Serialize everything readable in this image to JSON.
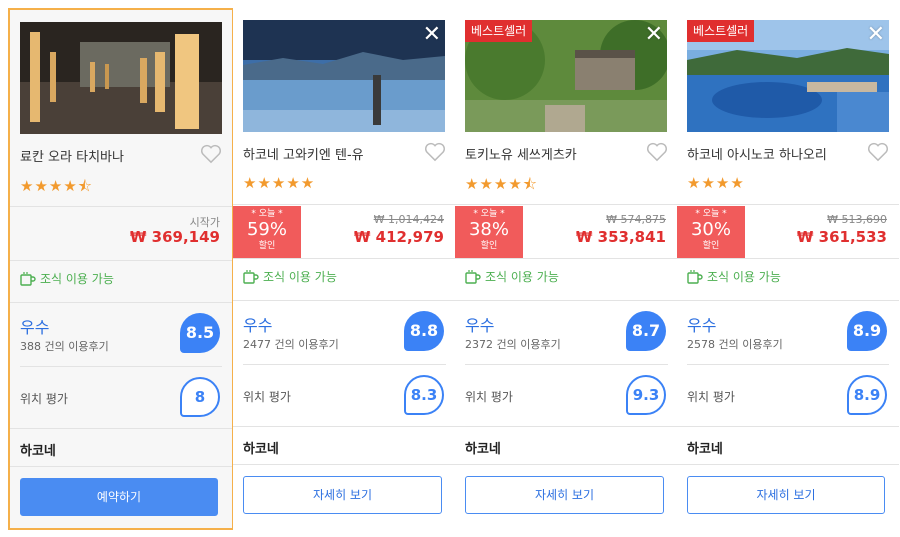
{
  "hotels": [
    {
      "name": "료칸 오라 타치바나",
      "stars": "★★★★⯪",
      "badge": "",
      "price_from_label": "시작가",
      "price": "₩ 369,149",
      "original_price": "",
      "discount_today": "",
      "discount_pct": "",
      "discount_word": "",
      "breakfast": "조식 이용 가능",
      "rating_word": "우수",
      "reviews": "388 건의 이용후기",
      "score": "8.5",
      "location_label": "위치 평가",
      "location_score": "8",
      "region": "하코네",
      "button": "예약하기"
    },
    {
      "name": "하코네 고와키엔 텐-유",
      "stars": "★★★★★",
      "badge": "",
      "price_from_label": "",
      "price": "₩ 412,979",
      "original_price": "₩ 1,014,424",
      "discount_today": "* 오늘 *",
      "discount_pct": "59%",
      "discount_word": "할인",
      "breakfast": "조식 이용 가능",
      "rating_word": "우수",
      "reviews": "2477 건의 이용후기",
      "score": "8.8",
      "location_label": "위치 평가",
      "location_score": "8.3",
      "region": "하코네",
      "button": "자세히 보기"
    },
    {
      "name": "토키노유 세쓰게츠카",
      "stars": "★★★★⯪",
      "badge": "베스트셀러",
      "price_from_label": "",
      "price": "₩ 353,841",
      "original_price": "₩ 574,875",
      "discount_today": "* 오늘 *",
      "discount_pct": "38%",
      "discount_word": "할인",
      "breakfast": "조식 이용 가능",
      "rating_word": "우수",
      "reviews": "2372 건의 이용후기",
      "score": "8.7",
      "location_label": "위치 평가",
      "location_score": "9.3",
      "region": "하코네",
      "button": "자세히 보기"
    },
    {
      "name": "하코네 아시노코 하나오리",
      "stars": "★★★★",
      "badge": "베스트셀러",
      "price_from_label": "",
      "price": "₩ 361,533",
      "original_price": "₩ 513,690",
      "discount_today": "* 오늘 *",
      "discount_pct": "30%",
      "discount_word": "할인",
      "breakfast": "조식 이용 가능",
      "rating_word": "우수",
      "reviews": "2578 건의 이용후기",
      "score": "8.9",
      "location_label": "위치 평가",
      "location_score": "8.9",
      "region": "하코네",
      "button": "자세히 보기"
    }
  ],
  "icons": {
    "close": "close-icon",
    "heart": "heart-icon",
    "cup": "coffee-cup-icon"
  },
  "colors": {
    "accent_blue": "#3b82f6",
    "price_red": "#e02f2f",
    "discount_bg": "#f15b5b",
    "breakfast_green": "#4caf50",
    "selected_border": "#f5b04a",
    "star_orange": "#f29a2e"
  }
}
